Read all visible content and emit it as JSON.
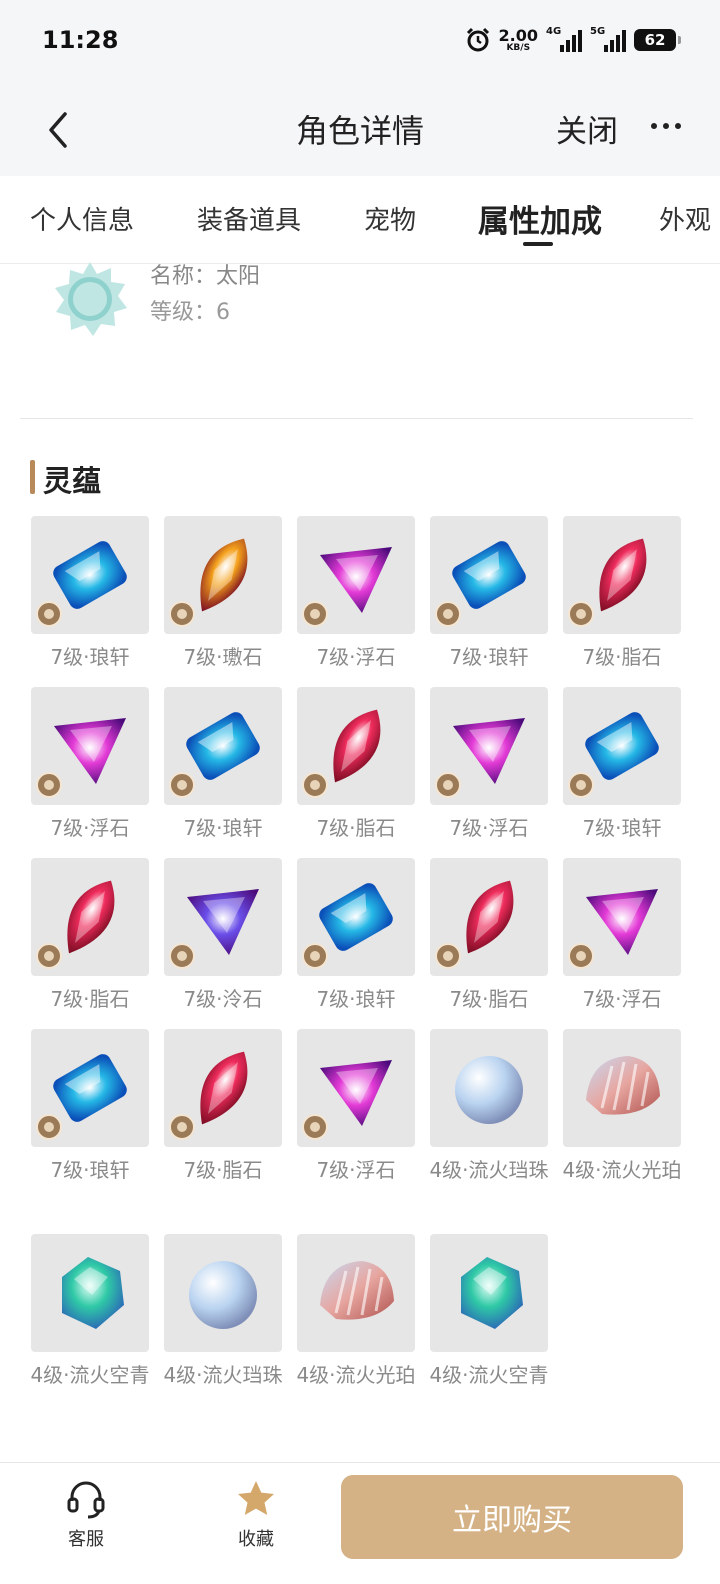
{
  "status": {
    "time": "11:28",
    "net_speed": "2.00",
    "net_unit": "KB/S",
    "sim1": "4G",
    "sim2": "5G",
    "battery": "62"
  },
  "nav": {
    "title": "角色详情",
    "close": "关闭"
  },
  "tabs": [
    {
      "label": "个人信息",
      "active": false
    },
    {
      "label": "装备道具",
      "active": false
    },
    {
      "label": "宠物",
      "active": false
    },
    {
      "label": "属性加成",
      "active": true
    },
    {
      "label": "外观",
      "active": false
    }
  ],
  "item": {
    "name": "名称：太阳",
    "level": "等级：6"
  },
  "section": {
    "title": "灵蕴"
  },
  "gems": [
    {
      "label": "7级·琅轩",
      "kind": "rect",
      "color": "#25b8e6",
      "badge": true
    },
    {
      "label": "7级·璷石",
      "kind": "drop",
      "color": "#f4a11c",
      "badge": true
    },
    {
      "label": "7级·浮石",
      "kind": "tri",
      "color": "#e33ad6",
      "badge": true
    },
    {
      "label": "7级·琅轩",
      "kind": "rect",
      "color": "#25b8e6",
      "badge": true
    },
    {
      "label": "7级·脂石",
      "kind": "drop",
      "color": "#ee2c5c",
      "badge": true
    },
    {
      "label": "7级·浮石",
      "kind": "tri",
      "color": "#e33ad6",
      "badge": true
    },
    {
      "label": "7级·琅轩",
      "kind": "rect",
      "color": "#25b8e6",
      "badge": true
    },
    {
      "label": "7级·脂石",
      "kind": "drop",
      "color": "#ee2c5c",
      "badge": true
    },
    {
      "label": "7级·浮石",
      "kind": "tri",
      "color": "#e33ad6",
      "badge": true
    },
    {
      "label": "7级·琅轩",
      "kind": "rect",
      "color": "#25b8e6",
      "badge": true
    },
    {
      "label": "7级·脂石",
      "kind": "drop",
      "color": "#ee2c5c",
      "badge": true
    },
    {
      "label": "7级·泠石",
      "kind": "tri",
      "color": "#6a4ee8",
      "badge": true
    },
    {
      "label": "7级·琅轩",
      "kind": "rect",
      "color": "#25b8e6",
      "badge": true
    },
    {
      "label": "7级·脂石",
      "kind": "drop",
      "color": "#ee2c5c",
      "badge": true
    },
    {
      "label": "7级·浮石",
      "kind": "tri",
      "color": "#e33ad6",
      "badge": true
    },
    {
      "label": "7级·琅轩",
      "kind": "rect",
      "color": "#25b8e6",
      "badge": true
    },
    {
      "label": "7级·脂石",
      "kind": "drop",
      "color": "#ee2c5c",
      "badge": true
    },
    {
      "label": "7级·浮石",
      "kind": "tri",
      "color": "#e33ad6",
      "badge": true
    },
    {
      "label": "4级·流火珰珠",
      "kind": "pearl",
      "color": "#b9d3f0",
      "badge": false
    },
    {
      "label": "4级·流火光珀",
      "kind": "shell",
      "color": "#e7a6a0",
      "badge": false
    },
    {
      "label": "4级·流火空青",
      "kind": "crystal",
      "color": "#2fc9a6",
      "badge": false
    },
    {
      "label": "4级·流火珰珠",
      "kind": "pearl",
      "color": "#b9d3f0",
      "badge": false
    },
    {
      "label": "4级·流火光珀",
      "kind": "shell",
      "color": "#e7a6a0",
      "badge": false
    },
    {
      "label": "4级·流火空青",
      "kind": "crystal",
      "color": "#2fc9a6",
      "badge": false
    }
  ],
  "bottom": {
    "service": "客服",
    "favorite": "收藏",
    "buy": "立即购买"
  },
  "colors": {
    "accent": "#d4b285",
    "section_bar": "#b88a5a",
    "star": "#d4a86a"
  }
}
